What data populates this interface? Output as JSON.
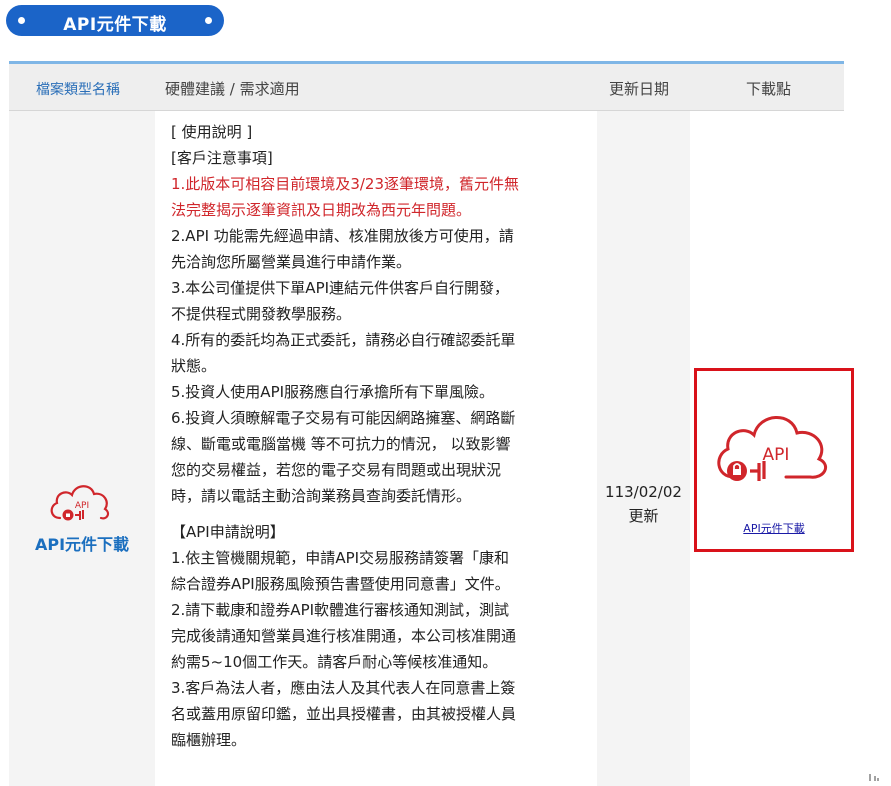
{
  "section": {
    "title": "API元件下載"
  },
  "table": {
    "headers": [
      "檔案類型名稱",
      "硬體建議 / 需求適用",
      "更新日期",
      "下載點"
    ],
    "row": {
      "type_label": "API元件下載",
      "icon": "cloud-api-icon",
      "description": [
        {
          "text": "[ 使用說明 ]",
          "style": "normal"
        },
        {
          "text": "[客戶注意事項]",
          "style": "normal"
        },
        {
          "text": "1.此版本可相容目前環境及3/23逐筆環境，舊元件無",
          "style": "red"
        },
        {
          "text": "法完整揭示逐筆資訊及日期改為西元年問題。",
          "style": "red"
        },
        {
          "text": "2.API 功能需先經過申請、核准開放後方可使用，請",
          "style": "normal"
        },
        {
          "text": "先洽詢您所屬營業員進行申請作業。",
          "style": "normal"
        },
        {
          "text": "3.本公司僅提供下單API連結元件供客戶自行開發，",
          "style": "normal"
        },
        {
          "text": "不提供程式開發教學服務。",
          "style": "normal"
        },
        {
          "text": "4.所有的委託均為正式委託，請務必自行確認委託單",
          "style": "normal"
        },
        {
          "text": "狀態。",
          "style": "normal"
        },
        {
          "text": "5.投資人使用API服務應自行承擔所有下單風險。",
          "style": "normal"
        },
        {
          "text": "6.投資人須瞭解電子交易有可能因網路擁塞、網路斷",
          "style": "normal"
        },
        {
          "text": "線、斷電或電腦當機 等不可抗力的情況， 以致影響",
          "style": "normal"
        },
        {
          "text": "您的交易權益，若您的電子交易有問題或出現狀況",
          "style": "normal"
        },
        {
          "text": "時，請以電話主動洽詢業務員查詢委託情形。",
          "style": "normal"
        },
        {
          "text": "",
          "style": "gap"
        },
        {
          "text": "【API申請說明】",
          "style": "normal"
        },
        {
          "text": "1.依主管機關規範，申請API交易服務請簽署「康和",
          "style": "normal"
        },
        {
          "text": "綜合證券API服務風險預告書暨使用同意書」文件。",
          "style": "normal"
        },
        {
          "text": "2.請下載康和證券API軟體進行審核通知測試，測試",
          "style": "normal"
        },
        {
          "text": "完成後請通知營業員進行核准開通，本公司核准開通",
          "style": "normal"
        },
        {
          "text": "約需5~10個工作天。請客戶耐心等候核准通知。",
          "style": "normal"
        },
        {
          "text": "3.客戶為法人者，應由法人及其代表人在同意書上簽",
          "style": "normal"
        },
        {
          "text": "名或蓋用原留印鑑，並出具授權書，由其被授權人員",
          "style": "normal"
        },
        {
          "text": "臨櫃辦理。",
          "style": "normal"
        }
      ],
      "update_date": "113/02/02",
      "update_note": "更新",
      "download": {
        "icon_text": "API",
        "link_label": "API元件下載"
      }
    }
  },
  "colors": {
    "accent": "#1b64c8",
    "red": "#d0262b",
    "highlight_border": "#d9121a"
  }
}
